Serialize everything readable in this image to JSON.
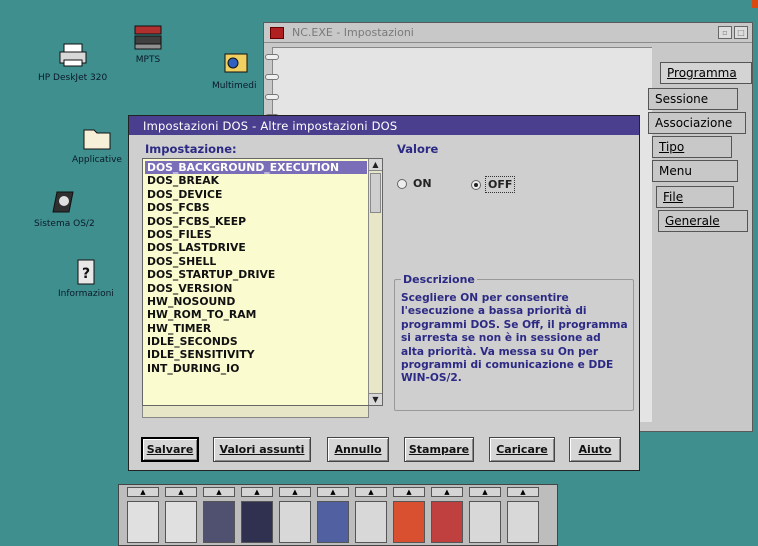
{
  "desktop": {
    "icons": [
      {
        "id": "printer",
        "label": "HP DeskJet 320",
        "icon": "printer-icon"
      },
      {
        "id": "mpts",
        "label": "MPTS",
        "icon": "mpts-icon"
      },
      {
        "id": "multimedia",
        "label": "Multimedi",
        "icon": "multimedia-icon"
      },
      {
        "id": "applicative",
        "label": "Applicative",
        "icon": "folder-icon"
      },
      {
        "id": "sistema",
        "label": "Sistema OS/2",
        "icon": "sistema-icon"
      },
      {
        "id": "informazioni",
        "label": "Informazioni",
        "icon": "info-icon"
      }
    ],
    "background_color": "#3f8f8e"
  },
  "notebook": {
    "title": "NC.EXE - Impostazioni",
    "tabs": [
      {
        "label": "Programma"
      },
      {
        "label": "Sessione"
      },
      {
        "label": "Associazione"
      },
      {
        "label": "Tipo"
      },
      {
        "label": "Menu"
      },
      {
        "label": "File"
      },
      {
        "label": "Generale"
      }
    ]
  },
  "dialog": {
    "title": "Impostazioni DOS - Altre impostazioni DOS",
    "settings_label": "Impostazione:",
    "value_label": "Valore",
    "settings": [
      "DOS_BACKGROUND_EXECUTION",
      "DOS_BREAK",
      "DOS_DEVICE",
      "DOS_FCBS",
      "DOS_FCBS_KEEP",
      "DOS_FILES",
      "DOS_LASTDRIVE",
      "DOS_SHELL",
      "DOS_STARTUP_DRIVE",
      "DOS_VERSION",
      "HW_NOSOUND",
      "HW_ROM_TO_RAM",
      "HW_TIMER",
      "IDLE_SECONDS",
      "IDLE_SENSITIVITY",
      "INT_DURING_IO"
    ],
    "selected_index": 0,
    "radio_on": "ON",
    "radio_off": "OFF",
    "selected_value": "OFF",
    "description_title": "Descrizione",
    "description_lines": [
      "Scegliere ON per consentire",
      "l'esecuzione a bassa priorità di",
      "programmi DOS. Se Off, il programma",
      "si arresta se non è in sessione ad",
      "alta priorità. Va messa su On per",
      "programmi di comunicazione e DDE",
      "WIN-OS/2."
    ],
    "buttons": {
      "save": "Salvare",
      "defaults": "Valori assunti",
      "cancel": "Annullo",
      "print": "Stampare",
      "load": "Caricare",
      "help": "Aiuto"
    },
    "title_bar_color": "#4a3f8f",
    "selection_color": "#7b6eb8",
    "list_background": "#fbfbd0"
  },
  "launchpad": {
    "tiles": [
      "lock-icon",
      "search-icon",
      "drive-icon",
      "window-icon",
      "printer-icon",
      "monitor-icon",
      "keyboard-icon",
      "calendar-icon",
      "puzzle-icon",
      "upload-icon",
      "chart-icon"
    ]
  }
}
